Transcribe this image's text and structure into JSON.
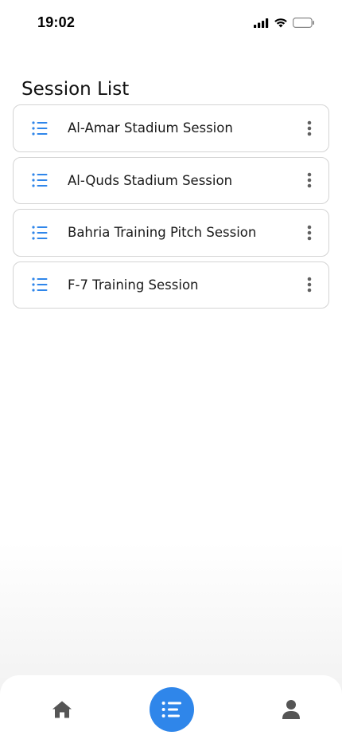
{
  "status_bar": {
    "time": "19:02",
    "icons": [
      "cellular-signal-icon",
      "wifi-icon",
      "battery-icon"
    ]
  },
  "page": {
    "title": "Session List"
  },
  "sessions": [
    {
      "name": "Al-Amar Stadium Session",
      "icon": "list-icon",
      "menu_icon": "more-vertical-icon"
    },
    {
      "name": "Al-Quds Stadium Session",
      "icon": "list-icon",
      "menu_icon": "more-vertical-icon"
    },
    {
      "name": "Bahria Training Pitch Session",
      "icon": "list-icon",
      "menu_icon": "more-vertical-icon"
    },
    {
      "name": "F-7 Training Session",
      "icon": "list-icon",
      "menu_icon": "more-vertical-icon"
    }
  ],
  "bottom_nav": {
    "items": [
      {
        "icon": "home-icon",
        "active": false
      },
      {
        "icon": "list-icon",
        "active": true
      },
      {
        "icon": "user-icon",
        "active": false
      }
    ]
  },
  "colors": {
    "accent": "#2f86ea",
    "icon_gray": "#555555",
    "border": "#d4d4d4"
  }
}
